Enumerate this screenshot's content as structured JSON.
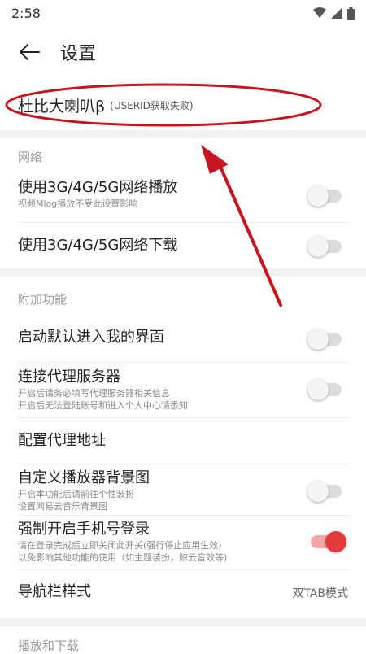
{
  "status": {
    "time": "2:58"
  },
  "appbar": {
    "title": "设置"
  },
  "account": {
    "name": "杜比大喇叭β",
    "sub": "(USERID获取失败)"
  },
  "sections": {
    "network": "网络",
    "extra": "附加功能",
    "playback": "播放和下载"
  },
  "settings": {
    "mobile_play": {
      "label": "使用3G/4G/5G网络播放",
      "desc": "视频Mlog播放不受此设置影响",
      "on": false
    },
    "mobile_download": {
      "label": "使用3G/4G/5G网络下载",
      "on": false
    },
    "default_my_page": {
      "label": "启动默认进入我的界面",
      "on": false
    },
    "proxy": {
      "label": "连接代理服务器",
      "desc1": "开启后请务必填写代理服务器相关信息",
      "desc2": "开启后无法登陆账号和进入个人中心请悉知",
      "on": false
    },
    "proxy_address": {
      "label": "配置代理地址"
    },
    "player_bg": {
      "label": "自定义播放器背景图",
      "desc1": "开启本功能后请前往个性装扮",
      "desc2": "设置网易云音乐背景图",
      "on": false
    },
    "force_phone_login": {
      "label": "强制开启手机号登录",
      "desc1": "请在登录完成后立即关闭此开关(强行停止应用生效)",
      "desc2": "以免影响其他功能的使用（如主题装扮，鲸云音效等)",
      "on": true
    },
    "nav_style": {
      "label": "导航栏样式",
      "value": "双TAB模式"
    }
  },
  "colors": {
    "accent": "#e33b3b",
    "annotation": "#c8141e"
  }
}
